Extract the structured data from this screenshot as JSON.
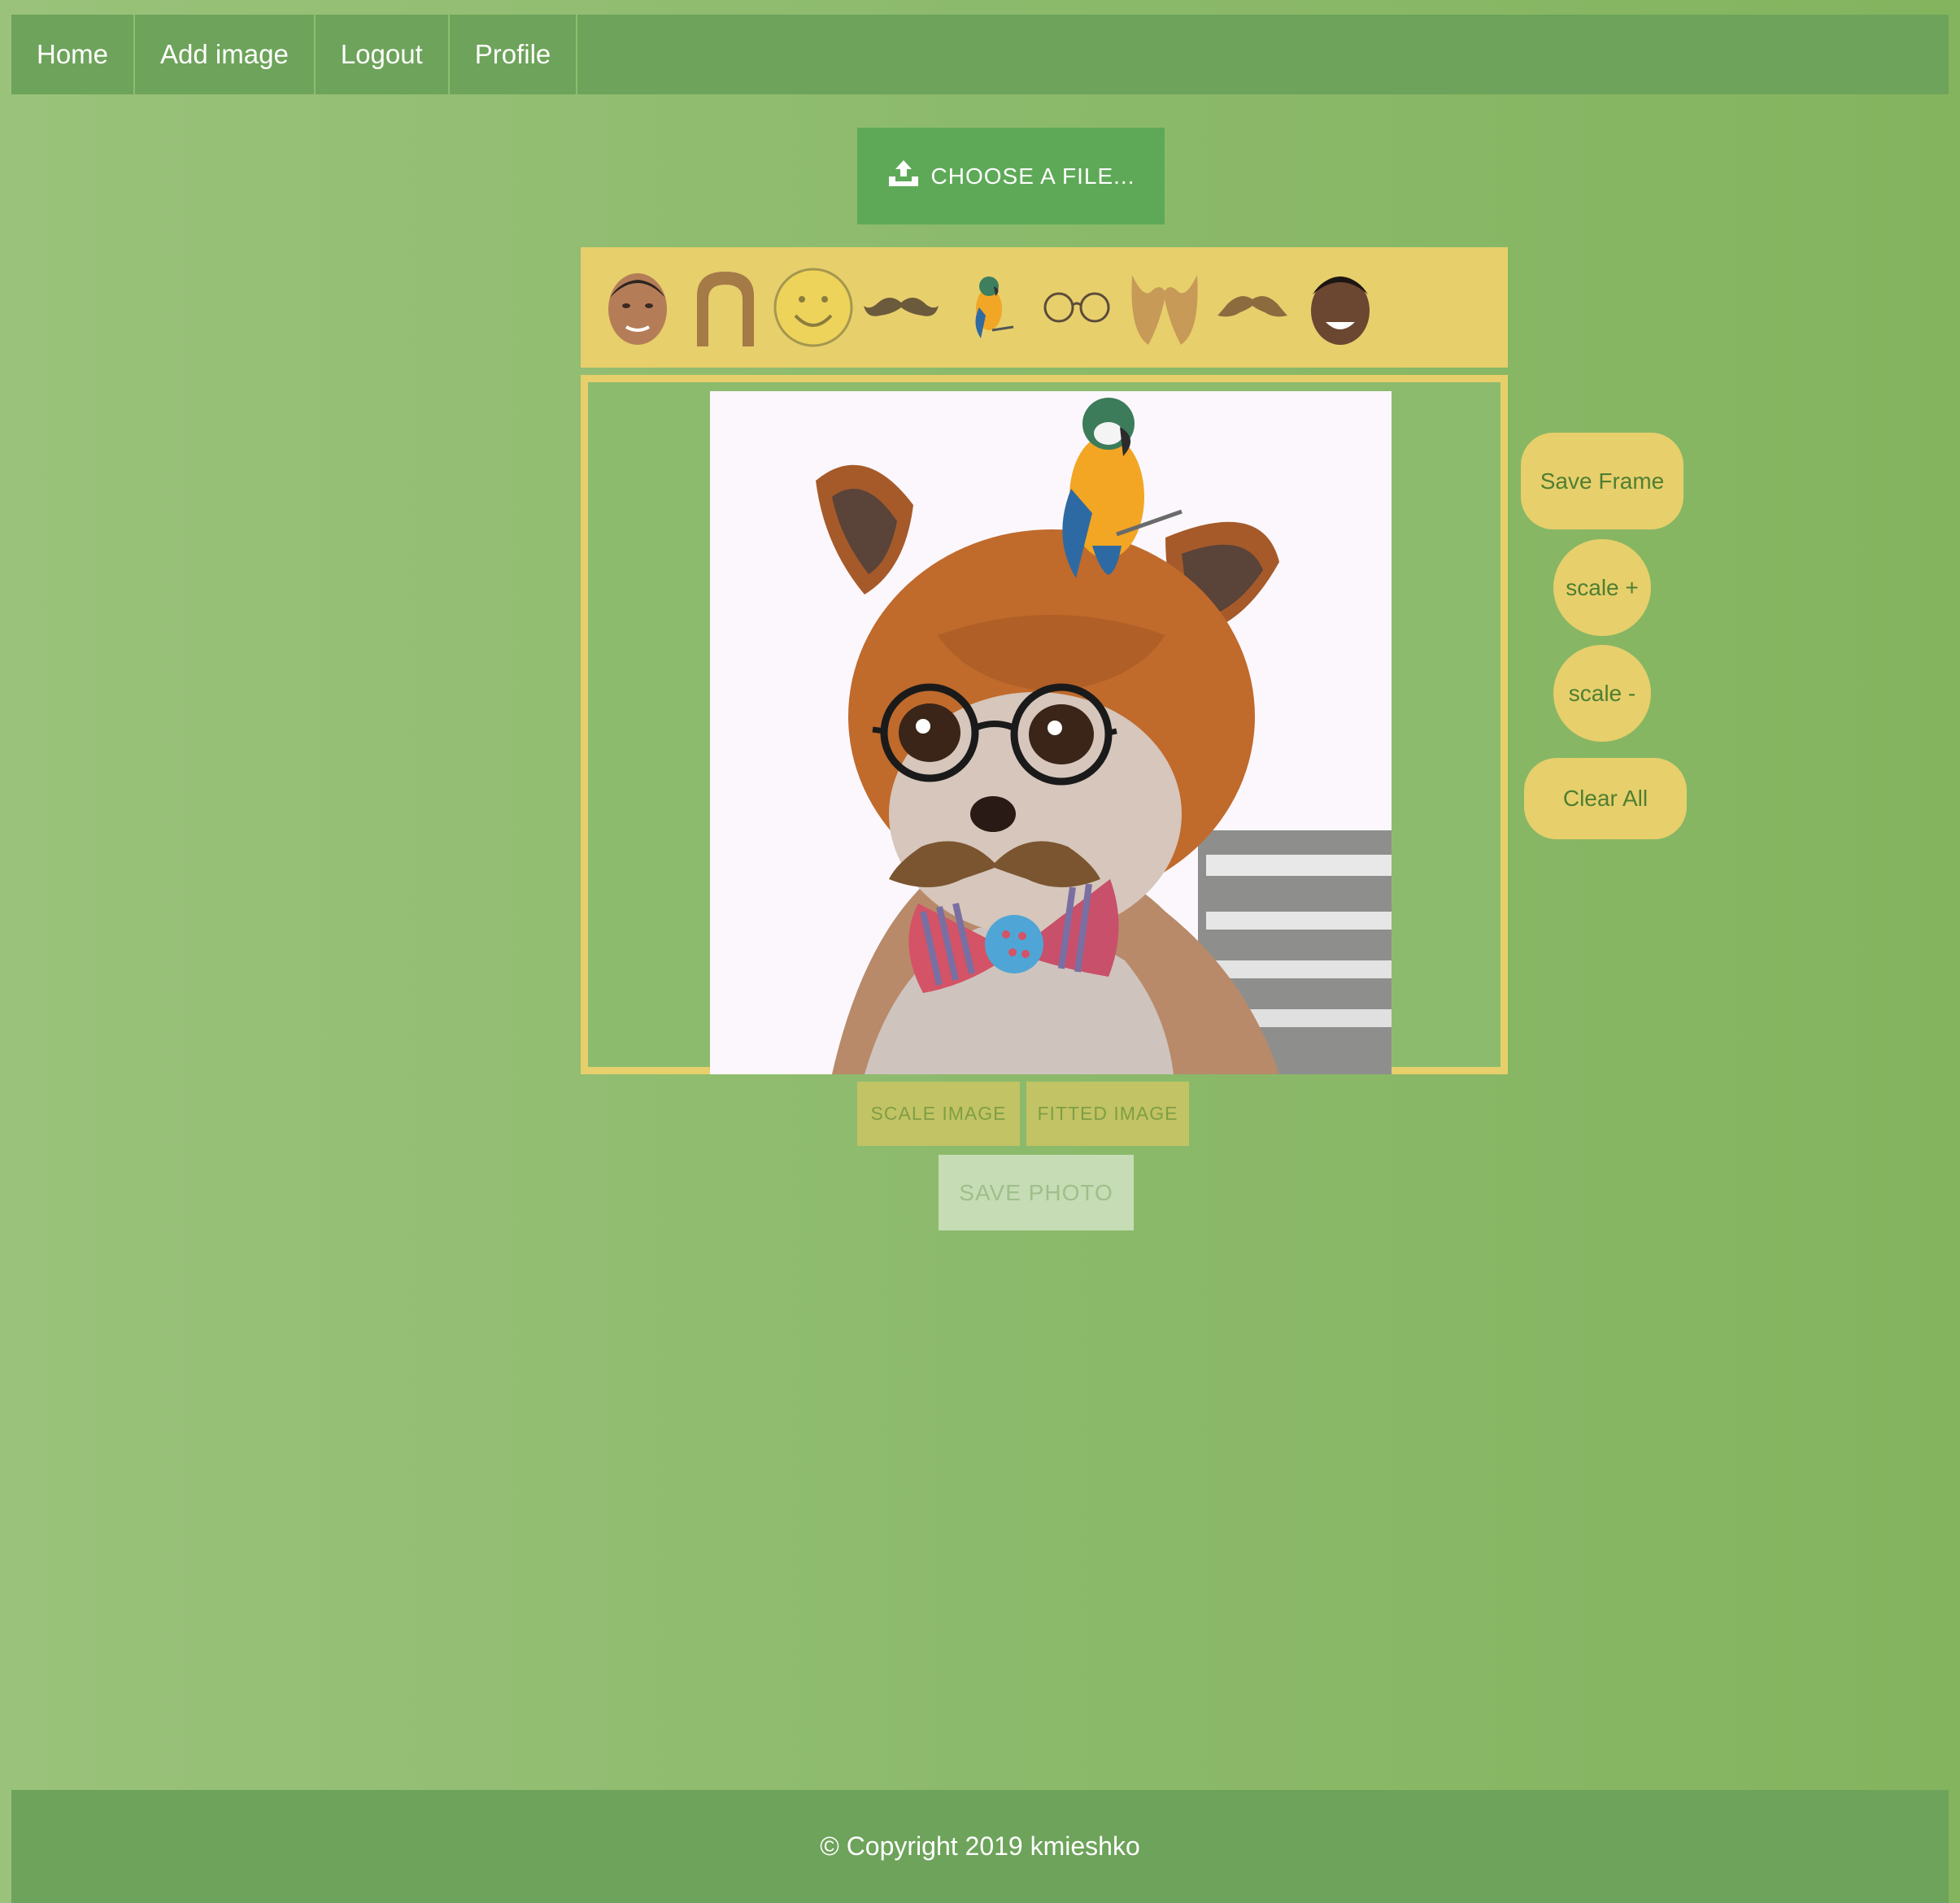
{
  "nav": {
    "items": [
      {
        "label": "Home"
      },
      {
        "label": "Add image"
      },
      {
        "label": "Logout"
      },
      {
        "label": "Profile"
      }
    ]
  },
  "upload": {
    "label": "CHOOSE A FILE...",
    "icon": "upload-icon"
  },
  "stickers": [
    {
      "name": "obama-face-sticker"
    },
    {
      "name": "hair-sticker"
    },
    {
      "name": "smiley-sticker"
    },
    {
      "name": "mustache-sticker"
    },
    {
      "name": "parrot-sticker"
    },
    {
      "name": "glasses-sticker"
    },
    {
      "name": "beard-sticker"
    },
    {
      "name": "mustache-2-sticker"
    },
    {
      "name": "will-smith-face-sticker"
    }
  ],
  "side_buttons": {
    "save_frame": "Save Frame",
    "scale_plus": "scale +",
    "scale_minus": "scale -",
    "clear_all": "Clear All"
  },
  "image_buttons": {
    "scale_image": "SCALE IMAGE",
    "fitted_image": "FITTED IMAGE",
    "save_photo": "SAVE PHOTO"
  },
  "footer": {
    "text": "© Copyright 2019 kmieshko"
  },
  "colors": {
    "nav": "#6da35a",
    "accent_yellow": "#e7cf6c",
    "upload_green": "#5ea958"
  }
}
